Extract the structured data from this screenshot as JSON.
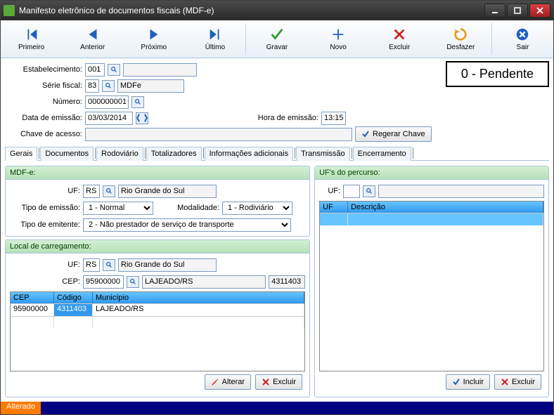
{
  "window": {
    "title": "Manifesto eletrônico de documentos fiscais (MDF-e)"
  },
  "toolbar": {
    "primeiro": "Primeiro",
    "anterior": "Anterior",
    "proximo": "Próximo",
    "ultimo": "Último",
    "gravar": "Gravar",
    "novo": "Novo",
    "excluir": "Excluir",
    "desfazer": "Desfazer",
    "sair": "Sair"
  },
  "status_box": "0 - Pendente",
  "form": {
    "estabelecimento_label": "Estabelecimento:",
    "estabelecimento": "001",
    "serie_label": "Série fiscal:",
    "serie": "83",
    "serie_desc": "MDFe",
    "numero_label": "Número:",
    "numero": "000000001",
    "data_emissao_label": "Data de emissão:",
    "data_emissao": "03/03/2014",
    "hora_label": "Hora de emissão:",
    "hora": "13:15",
    "chave_label": "Chave de acesso:",
    "chave": "",
    "regerar_btn": "Regerar Chave"
  },
  "tabs": [
    "Gerais",
    "Documentos",
    "Rodoviário",
    "Totalizadores",
    "Informações adicionais",
    "Transmissão",
    "Encerramento"
  ],
  "mdfe": {
    "title": "MDF-e:",
    "uf_label": "UF:",
    "uf": "RS",
    "uf_desc": "Rio Grande do Sul",
    "tipo_emissao_label": "Tipo de emissão:",
    "tipo_emissao": "1 - Normal",
    "modalidade_label": "Modalidade:",
    "modalidade": "1 - Rodiviário",
    "tipo_emitente_label": "Tipo de emitente:",
    "tipo_emitente": "2 - Não prestador de serviço de transporte"
  },
  "local": {
    "title": "Local de carregamento:",
    "uf_label": "UF:",
    "uf": "RS",
    "uf_desc": "Rio Grande do Sul",
    "cep_label": "CEP:",
    "cep": "95900000",
    "cep_desc": "LAJEADO/RS",
    "cep_code": "4311403",
    "cols": [
      "CEP",
      "Código",
      "Município"
    ],
    "row": [
      "95900000",
      "4311403",
      "LAJEADO/RS"
    ],
    "alterar": "Alterar",
    "excluir": "Excluir"
  },
  "percurso": {
    "title": "UF's do percurso:",
    "uf_label": "UF:",
    "cols": [
      "UF",
      "Descrição"
    ],
    "incluir": "Incluir",
    "excluir": "Excluir"
  },
  "statusbar": {
    "alterado": "Alterado"
  }
}
